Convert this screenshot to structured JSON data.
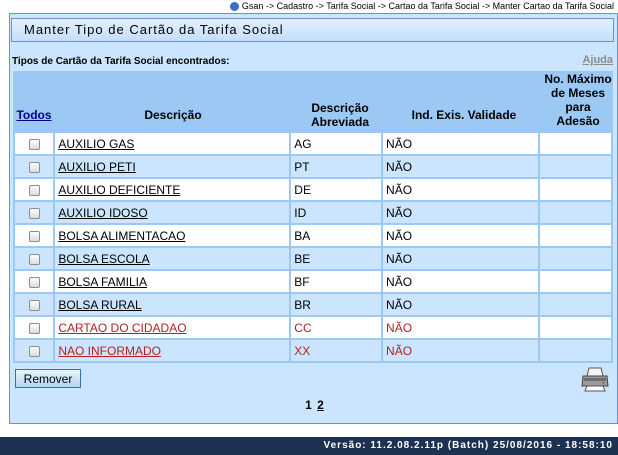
{
  "breadcrumb": "Gsan -> Cadastro -> Tarifa Social -> Cartao da Tarifa Social -> Manter Cartao da Tarifa Social",
  "title": "Manter Tipo de Cartão da Tarifa Social",
  "found_label": "Tipos de Cartão da Tarifa Social encontrados:",
  "help_link": "Ajuda",
  "headers": {
    "todos": "Todos",
    "descricao": "Descrição",
    "abreviada": "Descrição Abreviada",
    "validade": "Ind. Exis. Validade",
    "maximo": "No. Máximo de Meses para Adesão"
  },
  "rows": [
    {
      "descricao": "AUXILIO GAS",
      "abreviada": "AG",
      "validade": "NÃO",
      "maximo": ""
    },
    {
      "descricao": "AUXILIO PETI",
      "abreviada": "PT",
      "validade": "NÃO",
      "maximo": ""
    },
    {
      "descricao": "AUXILIO DEFICIENTE",
      "abreviada": "DE",
      "validade": "NÃO",
      "maximo": ""
    },
    {
      "descricao": "AUXILIO IDOSO",
      "abreviada": "ID",
      "validade": "NÃO",
      "maximo": ""
    },
    {
      "descricao": "BOLSA ALIMENTACAO",
      "abreviada": "BA",
      "validade": "NÃO",
      "maximo": ""
    },
    {
      "descricao": "BOLSA ESCOLA",
      "abreviada": "BE",
      "validade": "NÃO",
      "maximo": ""
    },
    {
      "descricao": "BOLSA FAMILIA",
      "abreviada": "BF",
      "validade": "NÃO",
      "maximo": ""
    },
    {
      "descricao": "BOLSA RURAL",
      "abreviada": "BR",
      "validade": "NÃO",
      "maximo": ""
    },
    {
      "descricao": "CARTAO DO CIDADAO",
      "abreviada": "CC",
      "validade": "NÃO",
      "maximo": ""
    },
    {
      "descricao": "NAO INFORMADO",
      "abreviada": "XX",
      "validade": "NÃO",
      "maximo": ""
    }
  ],
  "remove_button": "Remover",
  "pagination": {
    "current": "1",
    "next": "2"
  },
  "footer": "Versão: 11.2.08.2.11p (Batch) 25/08/2016 - 18:58:10",
  "colors": {
    "panel_bg": "#cbe5fe",
    "header_bg": "#9cc8f4",
    "inactive_text": "#b22222",
    "footer_bg": "#1d3252"
  }
}
